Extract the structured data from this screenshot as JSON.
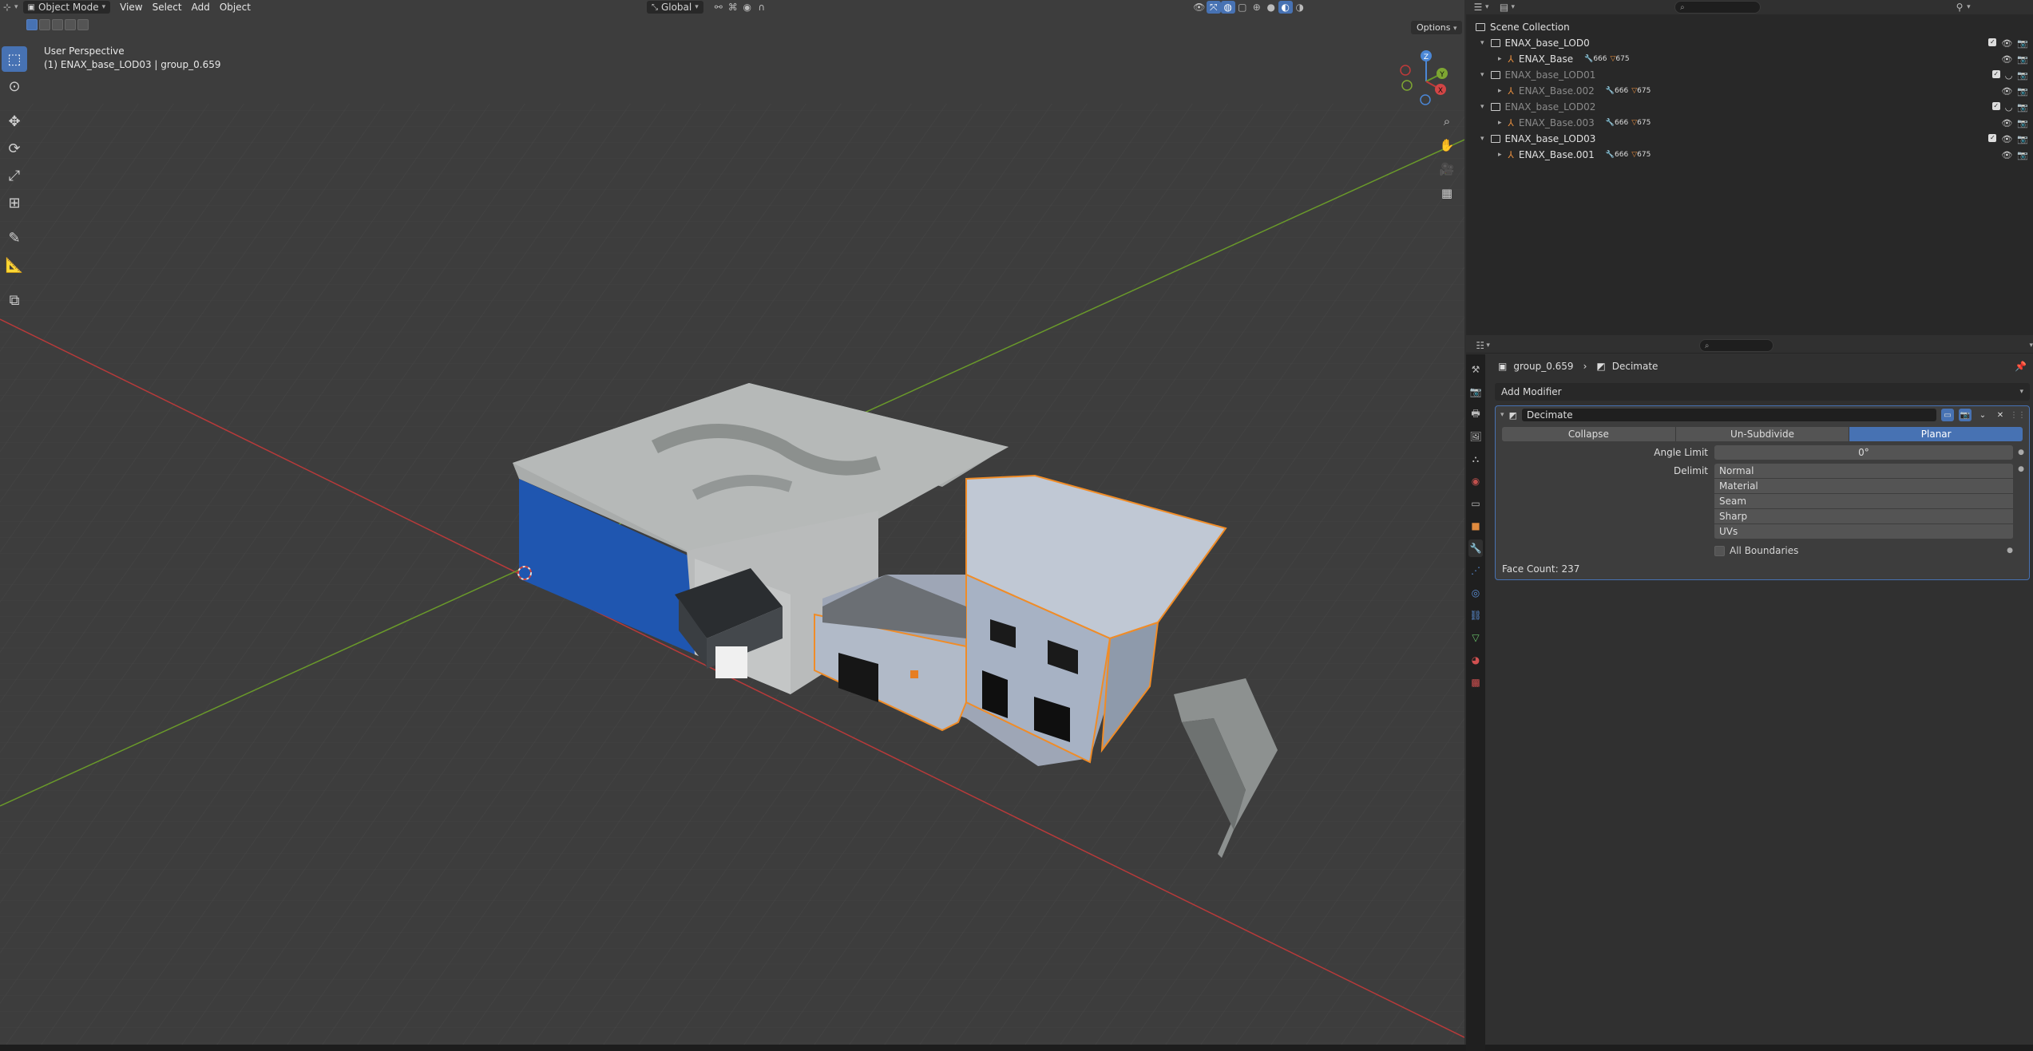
{
  "viewport": {
    "mode_label": "Object Mode",
    "menus": [
      "View",
      "Select",
      "Add",
      "Object"
    ],
    "orientation_label": "Global",
    "options_label": "Options",
    "info_line1": "User Perspective",
    "info_line2": "(1) ENAX_base_LOD03 | group_0.659",
    "gizmo_axes": [
      "Z",
      "Y",
      "X"
    ]
  },
  "toolbar_icons": [
    "select-box-icon",
    "cursor-icon",
    "move-icon",
    "rotate-icon",
    "scale-icon",
    "transform-icon",
    "annotate-icon",
    "measure-icon",
    "add-cube-icon"
  ],
  "outliner": {
    "root_label": "Scene Collection",
    "rows": [
      {
        "label": "ENAX_base_LOD0",
        "type": "collection",
        "dim": false
      },
      {
        "label": "ENAX_Base",
        "type": "object",
        "dim": false,
        "badge_a": "666",
        "badge_b": "675"
      },
      {
        "label": "ENAX_base_LOD01",
        "type": "collection",
        "dim": true
      },
      {
        "label": "ENAX_Base.002",
        "type": "object",
        "dim": true,
        "badge_a": "666",
        "badge_b": "675"
      },
      {
        "label": "ENAX_base_LOD02",
        "type": "collection",
        "dim": true
      },
      {
        "label": "ENAX_Base.003",
        "type": "object",
        "dim": true,
        "badge_a": "666",
        "badge_b": "675"
      },
      {
        "label": "ENAX_base_LOD03",
        "type": "collection",
        "dim": false
      },
      {
        "label": "ENAX_Base.001",
        "type": "object",
        "dim": false,
        "badge_a": "666",
        "badge_b": "675"
      }
    ]
  },
  "properties": {
    "breadcrumb_object": "group_0.659",
    "breadcrumb_modifier": "Decimate",
    "add_modifier_label": "Add Modifier",
    "modifier_name": "Decimate",
    "modes": [
      {
        "label": "Collapse",
        "active": false
      },
      {
        "label": "Un-Subdivide",
        "active": false
      },
      {
        "label": "Planar",
        "active": true
      }
    ],
    "angle_limit_label": "Angle Limit",
    "angle_limit_value": "0°",
    "delimit_label": "Delimit",
    "delimit_options": [
      "Normal",
      "Material",
      "Seam",
      "Sharp",
      "UVs"
    ],
    "all_boundaries_label": "All Boundaries",
    "face_count": "Face Count: 237"
  },
  "colors": {
    "accent": "#4772b3",
    "selection_outline": "#f08c27",
    "x_axis": "#b83a3a",
    "y_axis": "#6a9a2a"
  }
}
